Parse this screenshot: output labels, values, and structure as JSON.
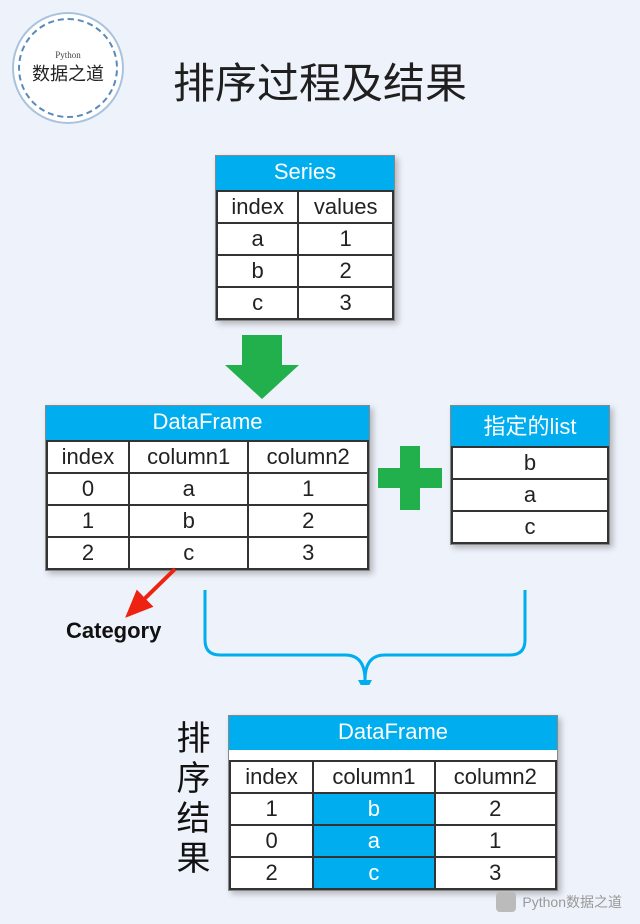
{
  "logo": {
    "small": "Python",
    "main": "数据之道"
  },
  "title": "排序过程及结果",
  "series": {
    "header": "Series",
    "cols": [
      "index",
      "values"
    ],
    "rows": [
      [
        "a",
        "1"
      ],
      [
        "b",
        "2"
      ],
      [
        "c",
        "3"
      ]
    ]
  },
  "dataframe": {
    "header": "DataFrame",
    "cols": [
      "index",
      "column1",
      "column2"
    ],
    "rows": [
      [
        "0",
        "a",
        "1"
      ],
      [
        "1",
        "b",
        "2"
      ],
      [
        "2",
        "c",
        "3"
      ]
    ]
  },
  "list": {
    "header": "指定的list",
    "rows": [
      "b",
      "a",
      "c"
    ]
  },
  "category_label": "Category",
  "result_label": "排序结果",
  "result": {
    "header": "DataFrame",
    "cols": [
      "index",
      "column1",
      "column2"
    ],
    "rows": [
      [
        "1",
        "b",
        "2"
      ],
      [
        "0",
        "a",
        "1"
      ],
      [
        "2",
        "c",
        "3"
      ]
    ]
  },
  "watermark": "Python数据之道",
  "colors": {
    "accent": "#00aeef",
    "green": "#21b04b",
    "red": "#e21"
  }
}
